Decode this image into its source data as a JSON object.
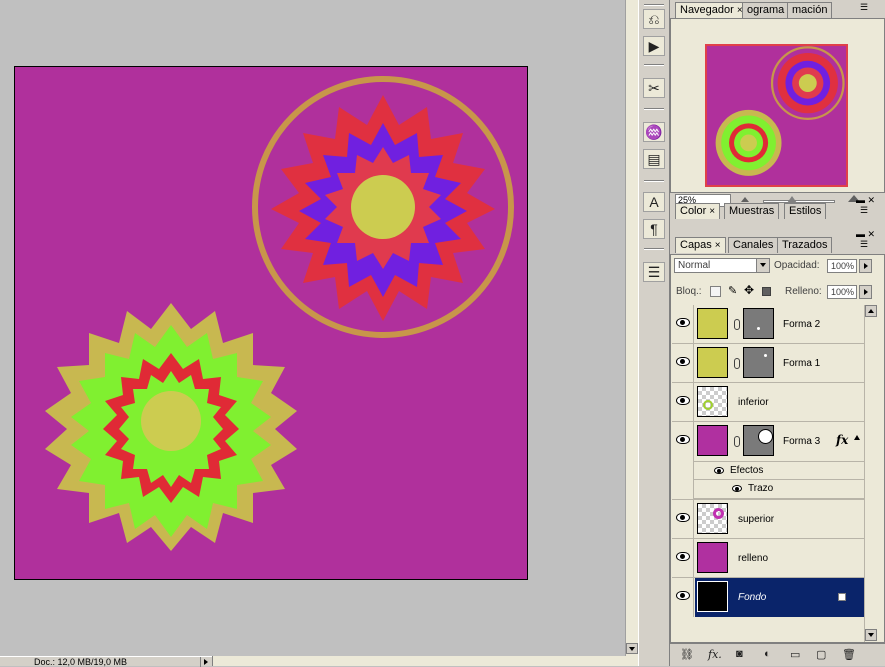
{
  "status_bar": {
    "doc_info": "Doc.: 12,0 MB/19,0 MB"
  },
  "navigator_panel": {
    "tabs": [
      {
        "label": "Navegador",
        "close": "×",
        "active": true
      },
      {
        "label": "ograma",
        "active": false
      },
      {
        "label": "mación",
        "active": false
      }
    ],
    "zoom": "25%"
  },
  "color_panel": {
    "tabs": [
      {
        "label": "Color",
        "close": "×",
        "active": true
      },
      {
        "label": "Muestras",
        "active": false
      },
      {
        "label": "Estilos",
        "active": false
      }
    ]
  },
  "layers_panel": {
    "tabs": [
      {
        "label": "Capas",
        "close": "×",
        "active": true
      },
      {
        "label": "Canales",
        "active": false
      },
      {
        "label": "Trazados",
        "active": false
      }
    ],
    "blend_mode": "Normal",
    "opacity_label": "Opacidad:",
    "opacity_value": "100%",
    "lock_label": "Bloq.:",
    "fill_label": "Relleno:",
    "fill_value": "100%",
    "layers": [
      {
        "name": "Forma 2",
        "thumb_color": "#cccc50",
        "mask": true,
        "visible": true
      },
      {
        "name": "Forma 1",
        "thumb_color": "#cccc50",
        "mask": true,
        "visible": true
      },
      {
        "name": "inferior",
        "thumb": "transparent",
        "visible": true
      },
      {
        "name": "Forma 3",
        "thumb_color": "#b030a0",
        "mask": true,
        "fx": "fx",
        "visible": true,
        "effects_label": "Efectos",
        "effects": [
          "Trazo"
        ]
      },
      {
        "name": "superior",
        "thumb": "transparent",
        "visible": true
      },
      {
        "name": "relleno",
        "thumb_color": "#b030a0",
        "visible": true
      },
      {
        "name": "Fondo",
        "thumb_color": "#000000",
        "visible": true,
        "selected": true,
        "locked": true
      }
    ]
  },
  "colors": {
    "canvas_bg": "#b0309c",
    "selection": "#0a246a",
    "workspace": "#c0c0c0"
  }
}
